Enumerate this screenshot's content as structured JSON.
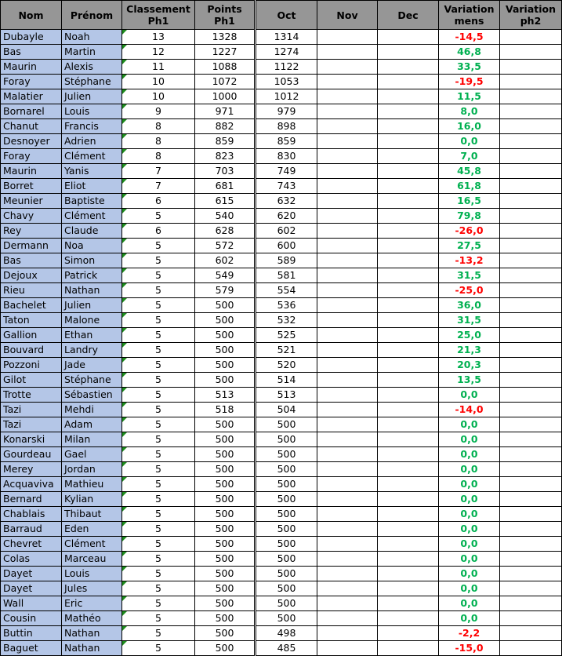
{
  "colors": {
    "header_bg": "#969696",
    "name_bg": "#b4c6e7",
    "positive": "#00b050",
    "negative": "#ff0000",
    "comment_flag": "#1e8c1e"
  },
  "headers": {
    "nom": "Nom",
    "prenom": "Prénom",
    "classement": "Classement Ph1",
    "points": "Points Ph1",
    "oct": "Oct",
    "nov": "Nov",
    "dec": "Dec",
    "variation_mens": "Variation mens",
    "variation_ph2": "Variation ph2"
  },
  "rows": [
    {
      "nom": "Dubayle",
      "prenom": "Noah",
      "classement": "13",
      "points": "1328",
      "oct": "1314",
      "nov": "",
      "dec": "",
      "variation_mens": "-14,5",
      "variation_ph2": ""
    },
    {
      "nom": "Bas",
      "prenom": "Martin",
      "classement": "12",
      "points": "1227",
      "oct": "1274",
      "nov": "",
      "dec": "",
      "variation_mens": "46,8",
      "variation_ph2": ""
    },
    {
      "nom": "Maurin",
      "prenom": "Alexis",
      "classement": "11",
      "points": "1088",
      "oct": "1122",
      "nov": "",
      "dec": "",
      "variation_mens": "33,5",
      "variation_ph2": ""
    },
    {
      "nom": "Foray",
      "prenom": "Stéphane",
      "classement": "10",
      "points": "1072",
      "oct": "1053",
      "nov": "",
      "dec": "",
      "variation_mens": "-19,5",
      "variation_ph2": ""
    },
    {
      "nom": "Malatier",
      "prenom": "Julien",
      "classement": "10",
      "points": "1000",
      "oct": "1012",
      "nov": "",
      "dec": "",
      "variation_mens": "11,5",
      "variation_ph2": ""
    },
    {
      "nom": "Bornarel",
      "prenom": "Louis",
      "classement": "9",
      "points": "971",
      "oct": "979",
      "nov": "",
      "dec": "",
      "variation_mens": "8,0",
      "variation_ph2": ""
    },
    {
      "nom": "Chanut",
      "prenom": "Francis",
      "classement": "8",
      "points": "882",
      "oct": "898",
      "nov": "",
      "dec": "",
      "variation_mens": "16,0",
      "variation_ph2": ""
    },
    {
      "nom": "Desnoyer",
      "prenom": "Adrien",
      "classement": "8",
      "points": "859",
      "oct": "859",
      "nov": "",
      "dec": "",
      "variation_mens": "0,0",
      "variation_ph2": ""
    },
    {
      "nom": "Foray",
      "prenom": "Clément",
      "classement": "8",
      "points": "823",
      "oct": "830",
      "nov": "",
      "dec": "",
      "variation_mens": "7,0",
      "variation_ph2": ""
    },
    {
      "nom": "Maurin",
      "prenom": "Yanis",
      "classement": "7",
      "points": "703",
      "oct": "749",
      "nov": "",
      "dec": "",
      "variation_mens": "45,8",
      "variation_ph2": ""
    },
    {
      "nom": "Borret",
      "prenom": "Eliot",
      "classement": "7",
      "points": "681",
      "oct": "743",
      "nov": "",
      "dec": "",
      "variation_mens": "61,8",
      "variation_ph2": ""
    },
    {
      "nom": "Meunier",
      "prenom": "Baptiste",
      "classement": "6",
      "points": "615",
      "oct": "632",
      "nov": "",
      "dec": "",
      "variation_mens": "16,5",
      "variation_ph2": ""
    },
    {
      "nom": "Chavy",
      "prenom": "Clément",
      "classement": "5",
      "points": "540",
      "oct": "620",
      "nov": "",
      "dec": "",
      "variation_mens": "79,8",
      "variation_ph2": ""
    },
    {
      "nom": "Rey",
      "prenom": "Claude",
      "classement": "6",
      "points": "628",
      "oct": "602",
      "nov": "",
      "dec": "",
      "variation_mens": "-26,0",
      "variation_ph2": ""
    },
    {
      "nom": "Dermann",
      "prenom": "Noa",
      "classement": "5",
      "points": "572",
      "oct": "600",
      "nov": "",
      "dec": "",
      "variation_mens": "27,5",
      "variation_ph2": ""
    },
    {
      "nom": "Bas",
      "prenom": "Simon",
      "classement": "5",
      "points": "602",
      "oct": "589",
      "nov": "",
      "dec": "",
      "variation_mens": "-13,2",
      "variation_ph2": ""
    },
    {
      "nom": "Dejoux",
      "prenom": "Patrick",
      "classement": "5",
      "points": "549",
      "oct": "581",
      "nov": "",
      "dec": "",
      "variation_mens": "31,5",
      "variation_ph2": ""
    },
    {
      "nom": "Rieu",
      "prenom": "Nathan",
      "classement": "5",
      "points": "579",
      "oct": "554",
      "nov": "",
      "dec": "",
      "variation_mens": "-25,0",
      "variation_ph2": ""
    },
    {
      "nom": "Bachelet",
      "prenom": "Julien",
      "classement": "5",
      "points": "500",
      "oct": "536",
      "nov": "",
      "dec": "",
      "variation_mens": "36,0",
      "variation_ph2": ""
    },
    {
      "nom": "Taton",
      "prenom": "Malone",
      "classement": "5",
      "points": "500",
      "oct": "532",
      "nov": "",
      "dec": "",
      "variation_mens": "31,5",
      "variation_ph2": ""
    },
    {
      "nom": "Gallion",
      "prenom": "Ethan",
      "classement": "5",
      "points": "500",
      "oct": "525",
      "nov": "",
      "dec": "",
      "variation_mens": "25,0",
      "variation_ph2": ""
    },
    {
      "nom": "Bouvard",
      "prenom": "Landry",
      "classement": "5",
      "points": "500",
      "oct": "521",
      "nov": "",
      "dec": "",
      "variation_mens": "21,3",
      "variation_ph2": ""
    },
    {
      "nom": "Pozzoni",
      "prenom": "Jade",
      "classement": "5",
      "points": "500",
      "oct": "520",
      "nov": "",
      "dec": "",
      "variation_mens": "20,3",
      "variation_ph2": ""
    },
    {
      "nom": "Gilot",
      "prenom": "Stéphane",
      "classement": "5",
      "points": "500",
      "oct": "514",
      "nov": "",
      "dec": "",
      "variation_mens": "13,5",
      "variation_ph2": ""
    },
    {
      "nom": "Trotte",
      "prenom": "Sébastien",
      "classement": "5",
      "points": "513",
      "oct": "513",
      "nov": "",
      "dec": "",
      "variation_mens": "0,0",
      "variation_ph2": ""
    },
    {
      "nom": "Tazi",
      "prenom": "Mehdi",
      "classement": "5",
      "points": "518",
      "oct": "504",
      "nov": "",
      "dec": "",
      "variation_mens": "-14,0",
      "variation_ph2": ""
    },
    {
      "nom": "Tazi",
      "prenom": "Adam",
      "classement": "5",
      "points": "500",
      "oct": "500",
      "nov": "",
      "dec": "",
      "variation_mens": "0,0",
      "variation_ph2": ""
    },
    {
      "nom": "Konarski",
      "prenom": "Milan",
      "classement": "5",
      "points": "500",
      "oct": "500",
      "nov": "",
      "dec": "",
      "variation_mens": "0,0",
      "variation_ph2": ""
    },
    {
      "nom": "Gourdeau",
      "prenom": "Gael",
      "classement": "5",
      "points": "500",
      "oct": "500",
      "nov": "",
      "dec": "",
      "variation_mens": "0,0",
      "variation_ph2": ""
    },
    {
      "nom": "Merey",
      "prenom": "Jordan",
      "classement": "5",
      "points": "500",
      "oct": "500",
      "nov": "",
      "dec": "",
      "variation_mens": "0,0",
      "variation_ph2": ""
    },
    {
      "nom": "Acquaviva",
      "prenom": "Mathieu",
      "classement": "5",
      "points": "500",
      "oct": "500",
      "nov": "",
      "dec": "",
      "variation_mens": "0,0",
      "variation_ph2": ""
    },
    {
      "nom": "Bernard",
      "prenom": "Kylian",
      "classement": "5",
      "points": "500",
      "oct": "500",
      "nov": "",
      "dec": "",
      "variation_mens": "0,0",
      "variation_ph2": ""
    },
    {
      "nom": "Chablais",
      "prenom": "Thibaut",
      "classement": "5",
      "points": "500",
      "oct": "500",
      "nov": "",
      "dec": "",
      "variation_mens": "0,0",
      "variation_ph2": ""
    },
    {
      "nom": "Barraud",
      "prenom": "Eden",
      "classement": "5",
      "points": "500",
      "oct": "500",
      "nov": "",
      "dec": "",
      "variation_mens": "0,0",
      "variation_ph2": ""
    },
    {
      "nom": "Chevret",
      "prenom": "Clément",
      "classement": "5",
      "points": "500",
      "oct": "500",
      "nov": "",
      "dec": "",
      "variation_mens": "0,0",
      "variation_ph2": ""
    },
    {
      "nom": "Colas",
      "prenom": "Marceau",
      "classement": "5",
      "points": "500",
      "oct": "500",
      "nov": "",
      "dec": "",
      "variation_mens": "0,0",
      "variation_ph2": ""
    },
    {
      "nom": "Dayet",
      "prenom": "Louis",
      "classement": "5",
      "points": "500",
      "oct": "500",
      "nov": "",
      "dec": "",
      "variation_mens": "0,0",
      "variation_ph2": ""
    },
    {
      "nom": "Dayet",
      "prenom": "Jules",
      "classement": "5",
      "points": "500",
      "oct": "500",
      "nov": "",
      "dec": "",
      "variation_mens": "0,0",
      "variation_ph2": ""
    },
    {
      "nom": "Wall",
      "prenom": "Eric",
      "classement": "5",
      "points": "500",
      "oct": "500",
      "nov": "",
      "dec": "",
      "variation_mens": "0,0",
      "variation_ph2": ""
    },
    {
      "nom": "Cousin",
      "prenom": "Mathéo",
      "classement": "5",
      "points": "500",
      "oct": "500",
      "nov": "",
      "dec": "",
      "variation_mens": "0,0",
      "variation_ph2": ""
    },
    {
      "nom": "Buttin",
      "prenom": "Nathan",
      "classement": "5",
      "points": "500",
      "oct": "498",
      "nov": "",
      "dec": "",
      "variation_mens": "-2,2",
      "variation_ph2": ""
    },
    {
      "nom": "Baguet",
      "prenom": "Nathan",
      "classement": "5",
      "points": "500",
      "oct": "485",
      "nov": "",
      "dec": "",
      "variation_mens": "-15,0",
      "variation_ph2": ""
    }
  ]
}
